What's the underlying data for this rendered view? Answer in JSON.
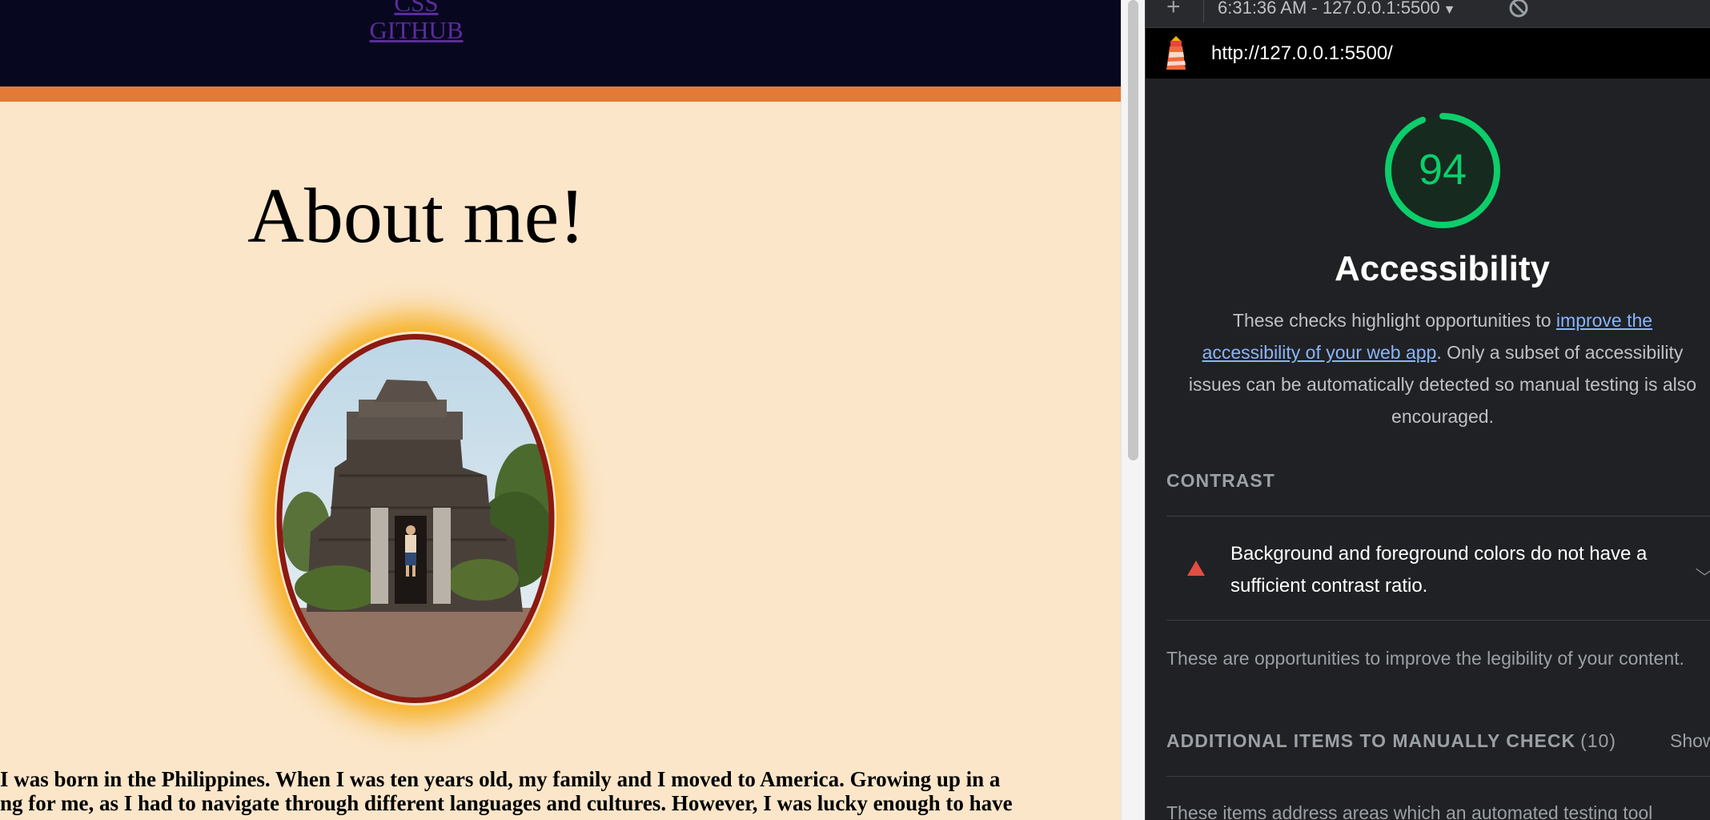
{
  "page": {
    "nav": {
      "css": "CSS",
      "github": "GITHUB"
    },
    "title": "About me!",
    "bio_lines": [
      "I was born in the Philippines. When I was ten years old, my family and I moved to America. Growing up in a",
      "ng for me, as I had to navigate through different languages and cultures. However, I was lucky enough to have"
    ]
  },
  "devtools": {
    "toolbar": {
      "add": "+",
      "report": "6:31:36 AM - 127.0.0.1:5500",
      "report_arrow": "▼"
    },
    "url": "http://127.0.0.1:5500/",
    "score": "94",
    "category_title": "Accessibility",
    "description": {
      "prefix": "These checks highlight opportunities to ",
      "link_part1": "improve the",
      "link_part2": "accessibility of your web app",
      "suffix_line2": ". Only a subset of accessibility",
      "line3": "issues can be automatically detected so manual testing is also",
      "line4": "encouraged."
    },
    "contrast": {
      "title": "CONTRAST",
      "audit_line1": "Background and foreground colors do not have a",
      "audit_line2": "sufficient contrast ratio.",
      "desc": "These are opportunities to improve the legibility of your content."
    },
    "manual": {
      "title": "ADDITIONAL ITEMS TO MANUALLY CHECK",
      "count": "(10)",
      "show": "Show",
      "desc": "These items address areas which an automated testing tool"
    }
  },
  "colors": {
    "score_pass": "#0cce6b",
    "audit_fail": "#e14d42",
    "header_bg": "#080720",
    "accent_bar": "#e37b36",
    "page_bg": "#fbe6c9"
  },
  "icons": [
    "lighthouse-logo-icon",
    "clear-icon",
    "add-icon",
    "fail-triangle-icon",
    "chevron-down-icon"
  ]
}
